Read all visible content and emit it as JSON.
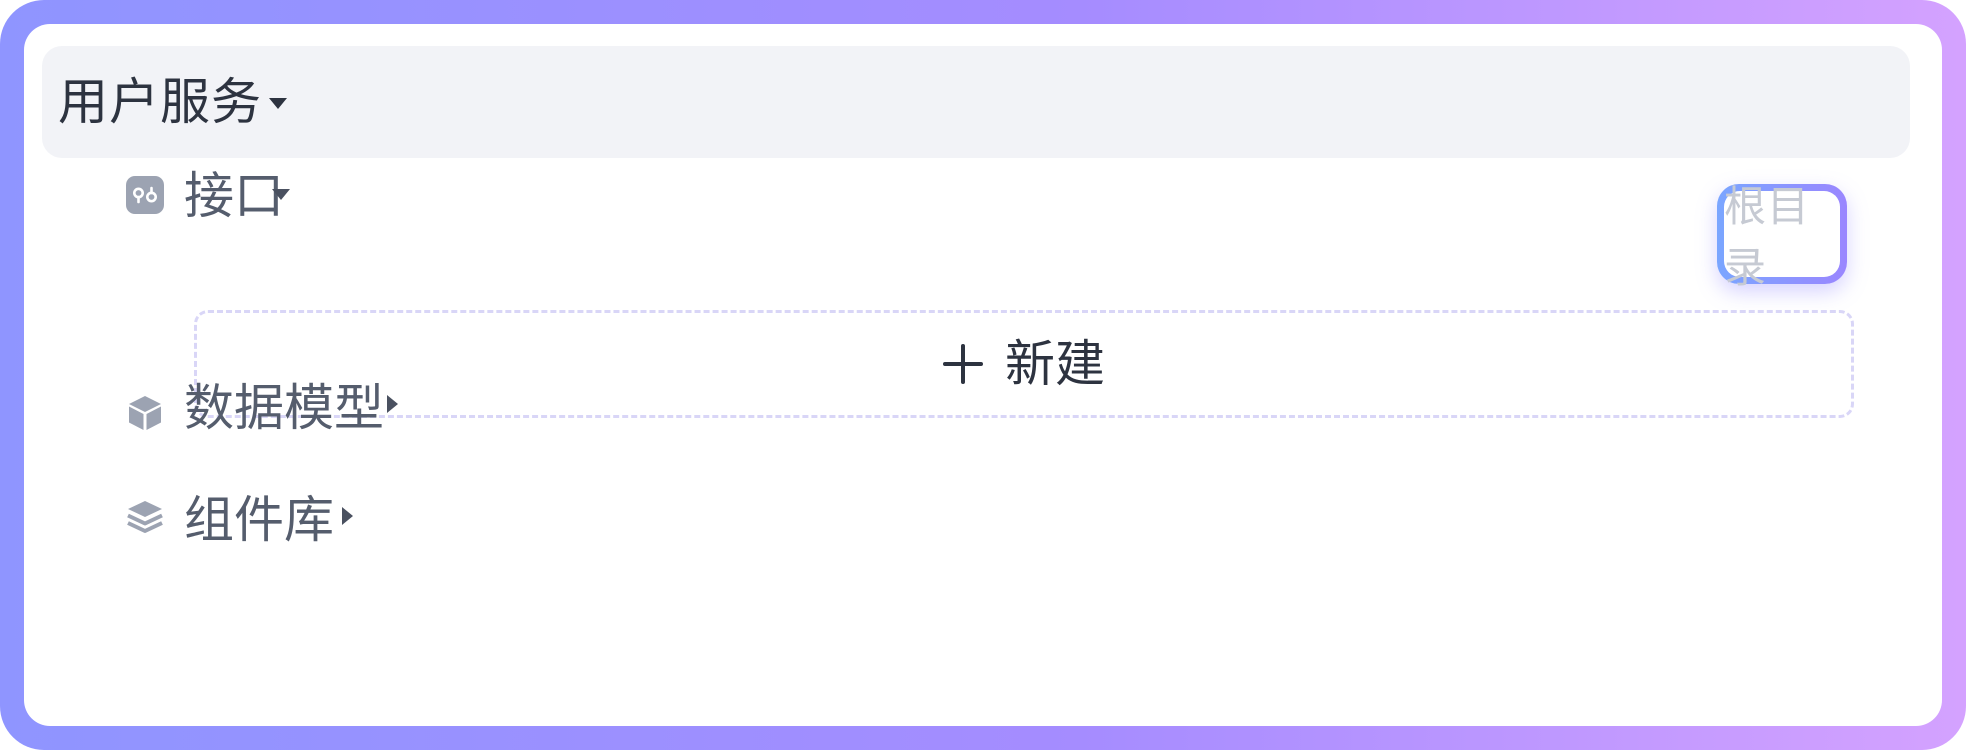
{
  "header": {
    "title": "用户服务"
  },
  "tree": {
    "items": [
      {
        "label": "接口",
        "icon": "api-icon",
        "state": "expanded"
      },
      {
        "label": "数据模型",
        "icon": "cube-icon",
        "state": "collapsed"
      },
      {
        "label": "组件库",
        "icon": "layers-icon",
        "state": "collapsed"
      }
    ],
    "new_button_label": "新建"
  },
  "root_tag": {
    "label": "根目录"
  },
  "colors": {
    "frame_gradient_start": "#8f95ff",
    "frame_gradient_end": "#d4a2ff",
    "header_bg": "#f2f3f7",
    "icon_gray": "#9ca3b2",
    "root_tag_border_start": "#7aa6ff",
    "root_tag_border_end": "#9a86ff"
  }
}
